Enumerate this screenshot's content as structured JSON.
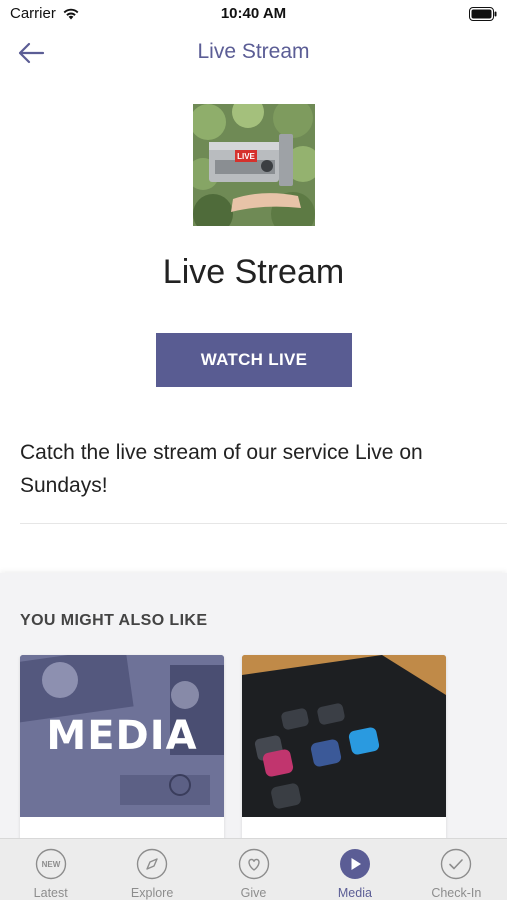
{
  "status_bar": {
    "carrier": "Carrier",
    "time": "10:40 AM"
  },
  "nav": {
    "title": "Live Stream",
    "back_icon": "arrow-left-icon"
  },
  "hero": {
    "image_label": "LIVE"
  },
  "page_title": "Live Stream",
  "watch_button": "WATCH LIVE",
  "description": "Catch the live stream of our service Live on Sundays!",
  "related": {
    "heading": "YOU MIGHT ALSO LIKE",
    "cards": [
      {
        "overlay_text": "MEDIA"
      },
      {
        "overlay_text": ""
      }
    ]
  },
  "tabs": [
    {
      "label": "Latest",
      "icon": "new-badge-icon",
      "icon_text": "NEW",
      "active": false
    },
    {
      "label": "Explore",
      "icon": "compass-icon",
      "active": false
    },
    {
      "label": "Give",
      "icon": "heart-icon",
      "active": false
    },
    {
      "label": "Media",
      "icon": "play-icon",
      "active": true
    },
    {
      "label": "Check-In",
      "icon": "checkmark-icon",
      "active": false
    }
  ],
  "colors": {
    "accent": "#595c92",
    "title": "#5b5d95",
    "tab_inactive": "#8d8d8d"
  }
}
